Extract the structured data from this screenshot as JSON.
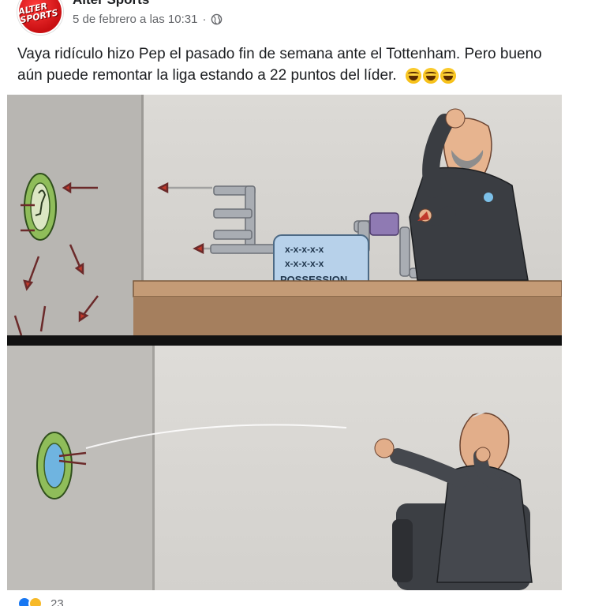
{
  "post": {
    "page_name": "Alter Sports",
    "avatar_text": "ALTER SPORTS",
    "timestamp": "5 de febrero a las 10:31",
    "audience_icon": "globe-icon",
    "separator": "·",
    "text": "Vaya ridículo hizo Pep el pasado fin de semana ante el Tottenham. Pero bueno aún puede remontar la liga estando a 22 puntos del líder.",
    "emojis": [
      "grinning-squinting-face-emoji",
      "grinning-squinting-face-emoji",
      "grinning-squinting-face-emoji"
    ]
  },
  "cartoon": {
    "machine_label": "POSSESSION",
    "machine_marks": "x-x-x-x-x"
  },
  "reactions": {
    "icons": [
      "like-icon",
      "haha-icon"
    ],
    "count": "23"
  },
  "colors": {
    "avatar_red": "#d11217",
    "text": "#1c1e21",
    "secondary_text": "#65676b",
    "panel_wall": "#d8d6d2",
    "panel_divider": "#121212",
    "desk": "#b48a68"
  }
}
